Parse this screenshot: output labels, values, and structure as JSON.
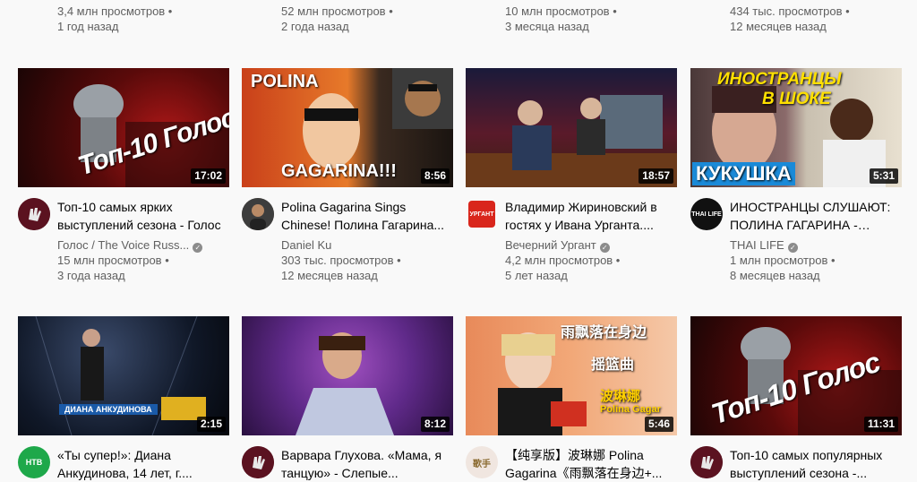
{
  "top_row": [
    {
      "views": "3,4 млн просмотров •",
      "age": "1 год назад"
    },
    {
      "views": "52 млн просмотров •",
      "age": "2 года назад"
    },
    {
      "views": "10 млн просмотров •",
      "age": "3 месяца назад"
    },
    {
      "views": "434 тыс. просмотров •",
      "age": "12 месяцев назад"
    }
  ],
  "videos": [
    {
      "duration": "17:02",
      "title": "Топ-10 самых ярких выступлений сезона - Голос",
      "channel": "Голос / The Voice Russ...",
      "verified": true,
      "views": "15 млн просмотров •",
      "age": "3 года назад",
      "thumb_text": "Топ-10 Голос",
      "avatar_icon": "voice-hand-icon"
    },
    {
      "duration": "8:56",
      "title": "Polina Gagarina Sings Chinese! Полина Гагарина...",
      "channel": "Daniel Ku",
      "verified": false,
      "views": "303 тыс. просмотров •",
      "age": "12 месяцев назад",
      "thumb_text_top": "POLINA",
      "thumb_text_bottom": "GAGARINA!!!",
      "avatar_icon": "person-avatar-icon"
    },
    {
      "duration": "18:57",
      "title": "Владимир Жириновский в гостях у Ивана Урганта....",
      "channel": "Вечерний Ургант",
      "verified": true,
      "views": "4,2 млн просмотров •",
      "age": "5 лет назад",
      "avatar_text": "УРГАНТ"
    },
    {
      "duration": "5:31",
      "title": "ИНОСТРАНЦЫ СЛУШАЮТ: ПОЛИНА ГАГАРИНА - КУКУШКА",
      "channel": "THAI LIFE",
      "verified": true,
      "views": "1 млн просмотров •",
      "age": "8 месяцев назад",
      "thumb_text_top": "ИНОСТРАНЦЫ",
      "thumb_text_mid": "В ШОКЕ",
      "thumb_text_bottom": "КУКУШКА",
      "avatar_text": "THAI LIFE"
    },
    {
      "duration": "2:15",
      "title": "«Ты супер!»: Диана Анкудинова, 14 лет, г....",
      "channel": "",
      "verified": false,
      "views": "",
      "age": "",
      "thumb_caption": "ДИАНА АНКУДИНОВА",
      "avatar_text": "НТВ"
    },
    {
      "duration": "8:12",
      "title": "Варвара Глухова. «Мама, я танцую» - Слепые...",
      "channel": "",
      "verified": false,
      "views": "",
      "age": "",
      "avatar_icon": "voice-hand-icon"
    },
    {
      "duration": "5:46",
      "title": "【纯享版】波琳娜 Polina Gagarina《雨飘落在身边+...",
      "channel": "",
      "verified": false,
      "views": "",
      "age": "",
      "thumb_text_top": "雨飘落在身边",
      "thumb_text_mid": "摇篮曲",
      "thumb_text_bottom": "波琳娜",
      "thumb_text_sub": "Polina Gagar",
      "avatar_text": "歌手"
    },
    {
      "duration": "11:31",
      "title": "Топ-10 самых популярных выступлений сезона -...",
      "channel": "",
      "verified": false,
      "views": "",
      "age": "",
      "thumb_text": "Топ-10 Голос",
      "avatar_icon": "voice-hand-icon"
    }
  ],
  "colors": {
    "background": "#f9f9f9",
    "title": "#030303",
    "meta": "#606060",
    "duration_bg": "#000000"
  }
}
